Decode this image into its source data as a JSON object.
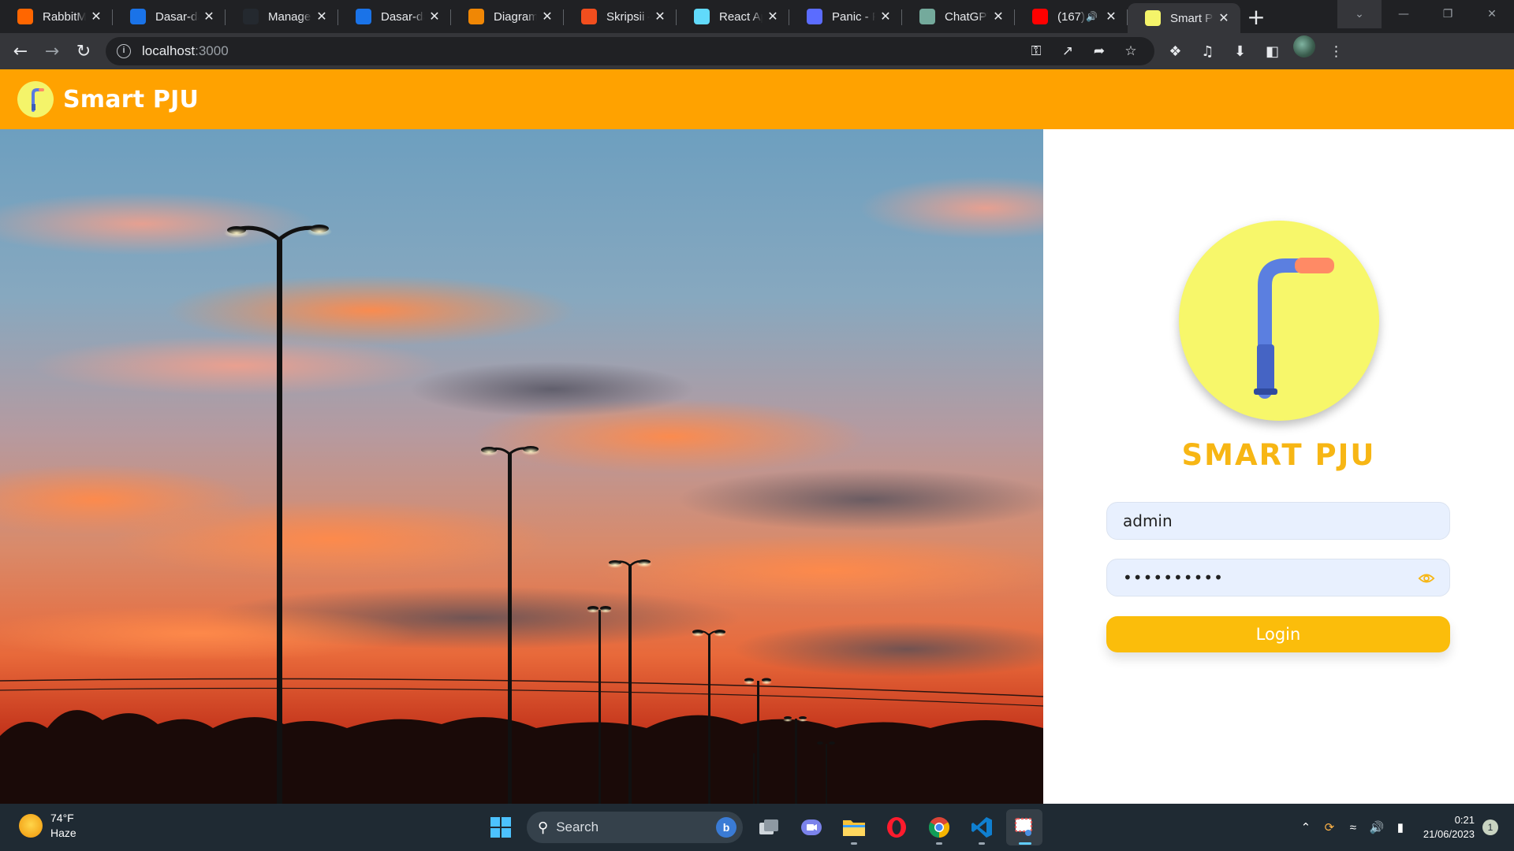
{
  "browser": {
    "tabs": [
      {
        "title": "RabbitMQ",
        "favicon": "rabbitmq-icon",
        "color": "#ff6600"
      },
      {
        "title": "Dasar-dasar",
        "favicon": "codepolitan-icon",
        "color": "#1a73e8"
      },
      {
        "title": "Manage access",
        "favicon": "github-icon",
        "color": "#24292f"
      },
      {
        "title": "Dasar-dasar",
        "favicon": "codepolitan-icon",
        "color": "#1a73e8"
      },
      {
        "title": "Diagram",
        "favicon": "diagram-icon",
        "color": "#f08705"
      },
      {
        "title": "Skripsii –",
        "favicon": "figma-icon",
        "color": "#f24e1e"
      },
      {
        "title": "React App",
        "favicon": "react-icon",
        "color": "#61dafb"
      },
      {
        "title": "Panic - Pr",
        "favicon": "panic-icon",
        "color": "#5b6cff"
      },
      {
        "title": "ChatGPT",
        "favicon": "chatgpt-icon",
        "color": "#74aa9c"
      },
      {
        "title": "(167)",
        "favicon": "youtube-icon",
        "color": "#ff0000",
        "audio": true
      },
      {
        "title": "Smart PJU",
        "favicon": "smart-pju-icon",
        "color": "#f4f46a",
        "active": true
      }
    ],
    "address": {
      "host": "localhost",
      "port": ":3000"
    }
  },
  "app": {
    "title": "Smart PJU"
  },
  "login": {
    "brand": "SMART PJU",
    "username_value": "admin",
    "password_value": "••••••••••",
    "login_label": "Login"
  },
  "taskbar": {
    "weather_temp": "74°F",
    "weather_desc": "Haze",
    "search_placeholder": "Search",
    "time": "0:21",
    "date": "21/06/2023",
    "notification_count": "1"
  },
  "colors": {
    "header": "#ffa200",
    "brand": "#f7b614",
    "login_button": "#fbbd0b",
    "logo_bg": "#f7f76a"
  }
}
